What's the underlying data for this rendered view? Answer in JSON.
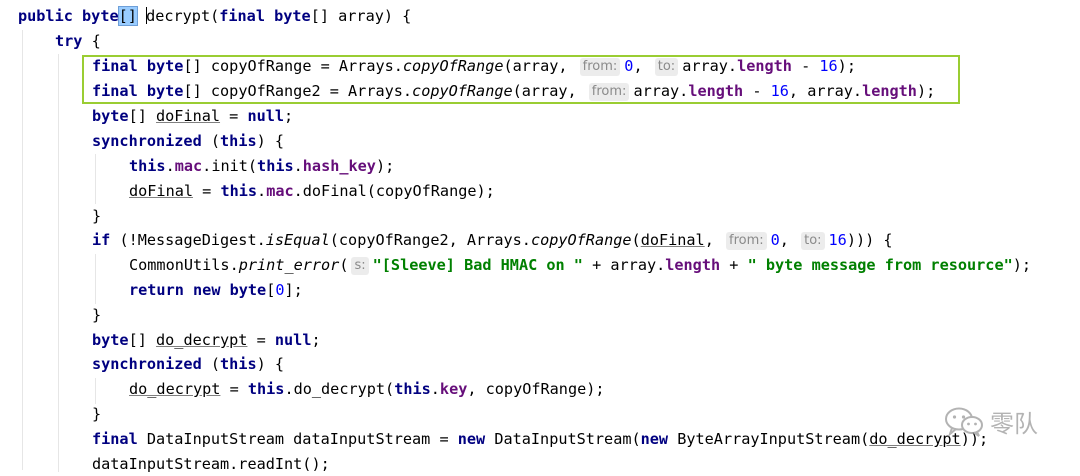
{
  "code": {
    "l1": {
      "public": "public",
      "byte": "byte",
      "br_open": "[",
      "br_close": "]",
      "name": "decrypt",
      "rest1": "(",
      "final": "final",
      "byte2": "byte",
      "rest2": "[] array) {"
    },
    "l2": {
      "try": "try",
      "rest": " {"
    },
    "l3": {
      "final": "final",
      "byte": "byte",
      "a": "[] copyOfRange = Arrays.",
      "method": "copyOfRange",
      "b": "(array, ",
      "hint_from": "from:",
      "n0": "0",
      "c": ", ",
      "hint_to": "to:",
      "d": "array.",
      "length": "length",
      "e": " - ",
      "n16": "16",
      "f": ");"
    },
    "l4": {
      "final": "final",
      "byte": "byte",
      "a": "[] copyOfRange2 = Arrays.",
      "method": "copyOfRange",
      "b": "(array, ",
      "hint_from": "from:",
      "d": "array.",
      "length": "length",
      "e": " - ",
      "n16": "16",
      "g": ", array.",
      "length2": "length",
      "f": ");"
    },
    "l5": {
      "byte": "byte",
      "a": "[] ",
      "var": "doFinal",
      "b": " = ",
      "null": "null",
      "c": ";"
    },
    "l6": {
      "sync": "synchronized",
      "a": " (",
      "this": "this",
      "b": ") {"
    },
    "l7": {
      "this": "this",
      "dot1": ".",
      "mac": "mac",
      "a": ".init(",
      "this2": "this",
      "dot2": ".",
      "key": "hash_key",
      "b": ");"
    },
    "l8": {
      "var": "doFinal",
      "a": " = ",
      "this": "this",
      "dot": ".",
      "mac": "mac",
      "b": ".doFinal(copyOfRange);"
    },
    "l9": {
      "a": "}"
    },
    "l10": {
      "if": "if",
      "a": " (!MessageDigest.",
      "method": "isEqual",
      "b": "(copyOfRange2, Arrays.",
      "method2": "copyOfRange",
      "c": "(",
      "var": "doFinal",
      "d": ", ",
      "hint_from": "from:",
      "n0": "0",
      "e": ", ",
      "hint_to": "to:",
      "n16": "16",
      "f": "))) {"
    },
    "l11": {
      "a": "CommonUtils.",
      "method": "print_error",
      "b": "(",
      "hint_s": "s:",
      "str1": "\"[Sleeve] Bad HMAC on \"",
      "c": " + array.",
      "length": "length",
      "d": " + ",
      "str2": "\" byte message from resource\"",
      "e": ");"
    },
    "l12": {
      "return": "return",
      "a": " ",
      "new": "new",
      "b": " ",
      "byte": "byte",
      "c": "[",
      "n0": "0",
      "d": "];"
    },
    "l13": {
      "a": "}"
    },
    "l14": {
      "byte": "byte",
      "a": "[] ",
      "var": "do_decrypt",
      "b": " = ",
      "null": "null",
      "c": ";"
    },
    "l15": {
      "sync": "synchronized",
      "a": " (",
      "this": "this",
      "b": ") {"
    },
    "l16": {
      "var": "do_decrypt",
      "a": " = ",
      "this": "this",
      "b": ".do_decrypt(",
      "this2": "this",
      "dot": ".",
      "key": "key",
      "c": ", copyOfRange);"
    },
    "l17": {
      "a": "}"
    },
    "l18": {
      "final": "final",
      "a": " DataInputStream dataInputStream = ",
      "new": "new",
      "b": " DataInputStream(",
      "new2": "new",
      "c": " ByteArrayInputStream(",
      "var": "do_decrypt",
      "d": "));"
    },
    "l19": {
      "a": "dataInputStream.readInt();"
    }
  },
  "watermark": {
    "text": "零队",
    "icon": "wechat-icon"
  },
  "colors": {
    "keyword": "#000080",
    "field": "#660e7a",
    "number": "#0000ff",
    "string": "#008000",
    "hint_bg": "#ececec",
    "selection_box": "#9acd32",
    "brace_highlight": "#99ccff"
  }
}
